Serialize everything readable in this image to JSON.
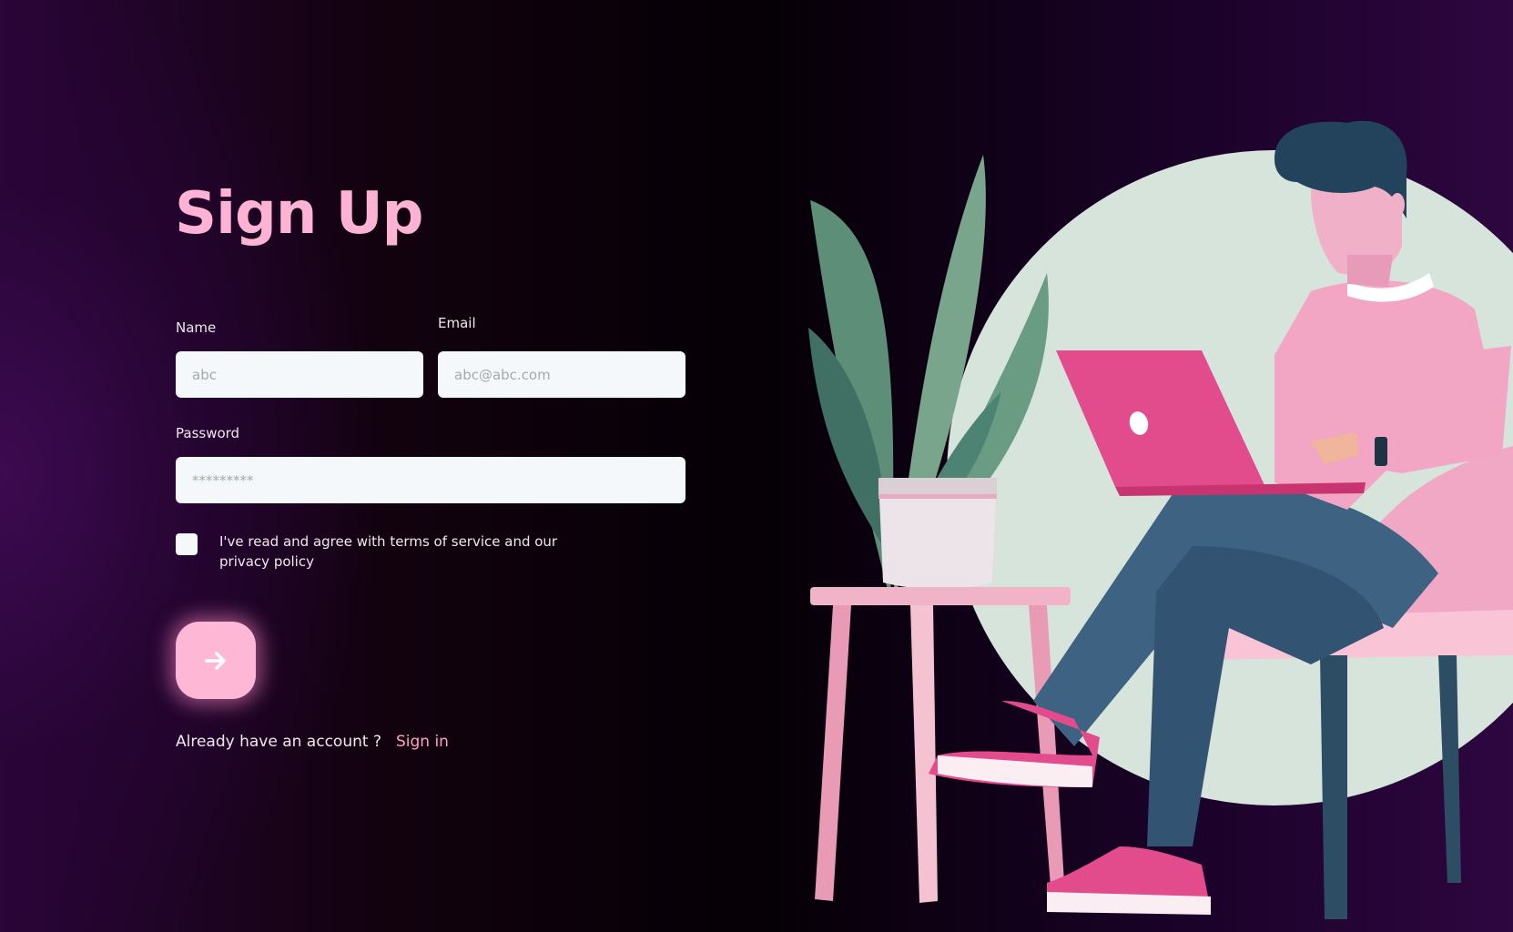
{
  "title": "Sign Up",
  "form": {
    "name_label": "Name",
    "name_placeholder": "abc",
    "email_label": "Email",
    "email_placeholder": "abc@abc.com",
    "password_label": "Password",
    "password_placeholder": "*********",
    "terms_text": "I've read and agree with terms of service and our privacy policy",
    "submit_icon": "arrow-right-icon"
  },
  "footer": {
    "prompt": "Already have an account ?",
    "signin_link": "Sign in"
  },
  "illustration": {
    "icon": "person-with-laptop-illustration"
  },
  "colors": {
    "accent": "#ffb3d4",
    "link": "#ff9fca",
    "input_bg": "#f4f8fa",
    "bg_dark": "#050005",
    "bg_purple": "#3c0a50"
  }
}
